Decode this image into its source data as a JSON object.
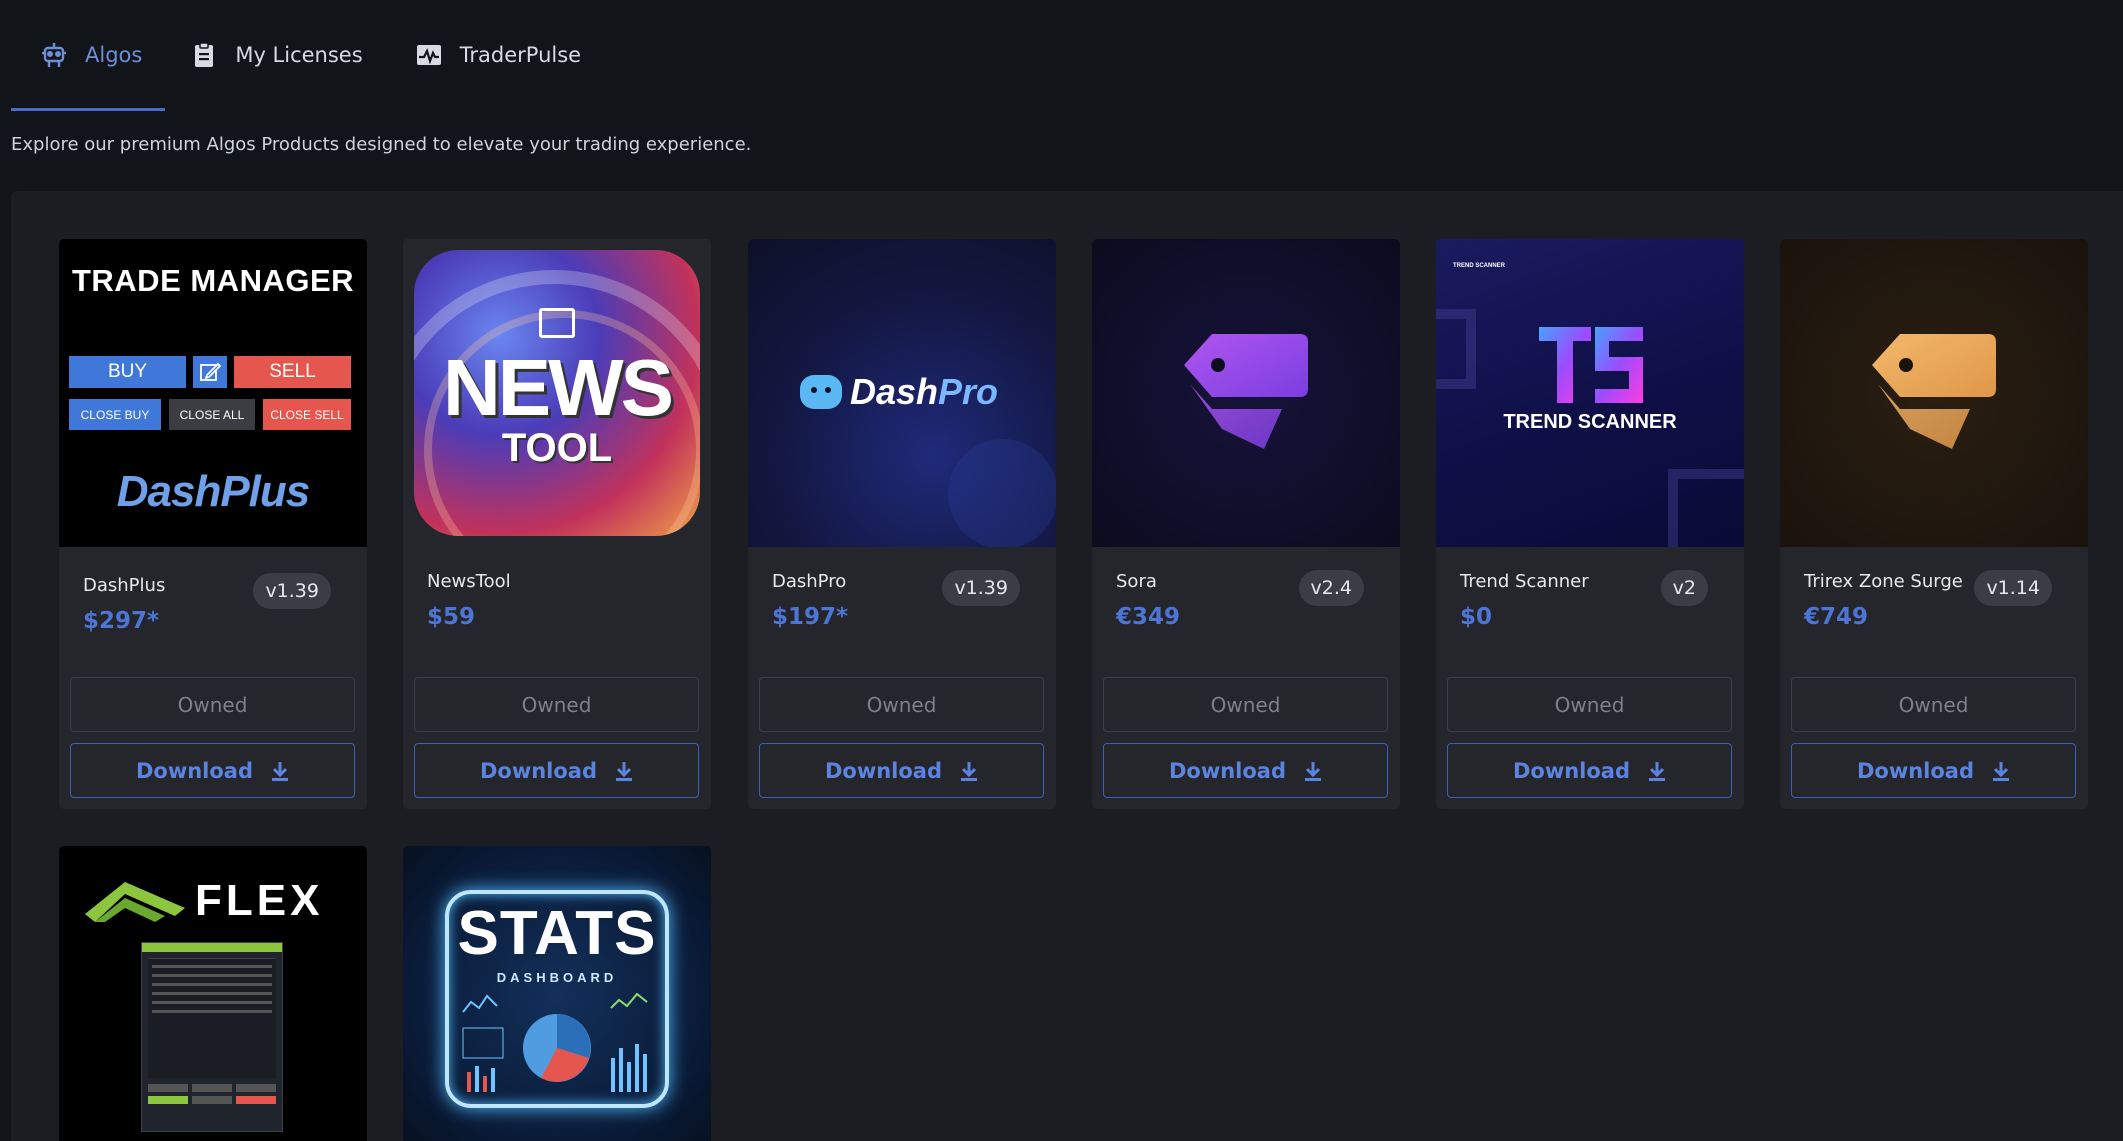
{
  "tabs": [
    {
      "label": "Algos",
      "icon": "robot-icon",
      "active": true
    },
    {
      "label": "My Licenses",
      "icon": "clipboard-icon",
      "active": false
    },
    {
      "label": "TraderPulse",
      "icon": "pulse-chart-icon",
      "active": false
    }
  ],
  "subtitle": "Explore our premium Algos Products designed to elevate your trading experience.",
  "colors": {
    "accent": "#4d75d6",
    "background": "#111419",
    "panel": "#1b1d22",
    "card": "#24262c"
  },
  "owned_label": "Owned",
  "download_label": "Download",
  "products": [
    {
      "name": "DashPlus",
      "price": "$297*",
      "version": "v1.39",
      "thumb": {
        "title": "TRADE MANAGER",
        "buy": "BUY",
        "sell": "SELL",
        "close_buy": "CLOSE BUY",
        "close_all": "CLOSE ALL",
        "close_sell": "CLOSE SELL",
        "brand": "DashPlus"
      }
    },
    {
      "name": "NewsTool",
      "price": "$59",
      "version": "",
      "thumb": {
        "line1": "NEWS",
        "line2": "TOOL"
      }
    },
    {
      "name": "DashPro",
      "price": "$197*",
      "version": "v1.39",
      "thumb": {
        "brand_a": "Dash",
        "brand_b": "Pro"
      }
    },
    {
      "name": "Sora",
      "price": "€349",
      "version": "v2.4",
      "thumb": {
        "icon": "price-tag-icon",
        "color": "#8b4cf0"
      }
    },
    {
      "name": "Trend Scanner",
      "price": "$0",
      "version": "v2",
      "thumb": {
        "small": "TREND SCANNER",
        "label": "TREND SCANNER"
      }
    },
    {
      "name": "Trirex Zone Surge",
      "price": "€749",
      "version": "v1.14",
      "thumb": {
        "icon": "price-tag-icon",
        "color": "#eba65a"
      }
    },
    {
      "name": "",
      "price": "",
      "version": "",
      "thumb": {
        "brand": "FLEX"
      }
    },
    {
      "name": "",
      "price": "",
      "version": "",
      "thumb": {
        "line1": "STATS",
        "line2": "DASHBOARD"
      }
    }
  ]
}
